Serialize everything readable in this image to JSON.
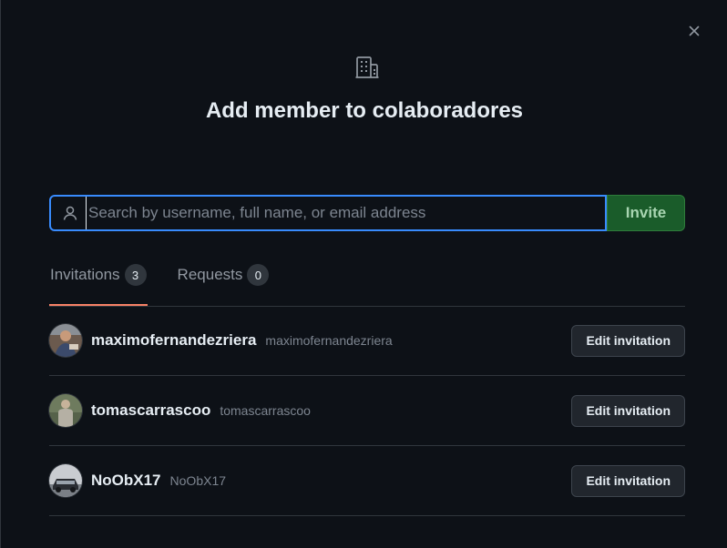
{
  "dialog": {
    "title": "Add member to colaboradores",
    "header_icon": "organization-icon",
    "close_icon": "close-icon"
  },
  "search": {
    "placeholder": "Search by username, full name, or email address",
    "value": "",
    "icon": "person-icon",
    "invite_label": "Invite"
  },
  "tabs": [
    {
      "label": "Invitations",
      "count": "3",
      "active": true
    },
    {
      "label": "Requests",
      "count": "0",
      "active": false
    }
  ],
  "members": [
    {
      "name": "maximofernandezriera",
      "login": "maximofernandezriera",
      "action_label": "Edit invitation"
    },
    {
      "name": "tomascarrascoo",
      "login": "tomascarrascoo",
      "action_label": "Edit invitation"
    },
    {
      "name": "NoObX17",
      "login": "NoObX17",
      "action_label": "Edit invitation"
    }
  ],
  "colors": {
    "background": "#0d1117",
    "focus_border": "#388bfd",
    "invite_button": "#1a5c2a",
    "active_tab_underline": "#f78166",
    "counter_bg": "#30363d"
  }
}
